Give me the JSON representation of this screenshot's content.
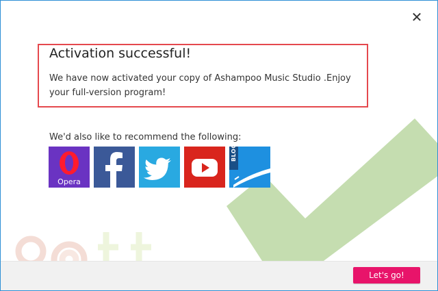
{
  "dialog": {
    "close_glyph": "✕",
    "title": "Activation successful!",
    "message": "We have now activated your copy of Ashampoo Music Studio .Enjoy your full-version program!",
    "recommend_label": "We'd also like to recommend the following:",
    "tiles": [
      {
        "name": "opera",
        "label": "Opera",
        "icon": "opera-icon",
        "color": "#6a33c2"
      },
      {
        "name": "facebook",
        "icon": "facebook-icon",
        "color": "#3b5998"
      },
      {
        "name": "twitter",
        "icon": "twitter-icon",
        "color": "#29a9e1"
      },
      {
        "name": "youtube",
        "icon": "youtube-icon",
        "color": "#d9251d"
      },
      {
        "name": "blog",
        "label": "BLOG",
        "icon": "blog-icon",
        "color": "#1e90e0"
      }
    ],
    "cta_label": "Let's go!",
    "colors": {
      "accent": "#e8146a",
      "highlight": "#e5484d",
      "check": "#c5ddb0",
      "frame": "#2d8fd5"
    }
  }
}
